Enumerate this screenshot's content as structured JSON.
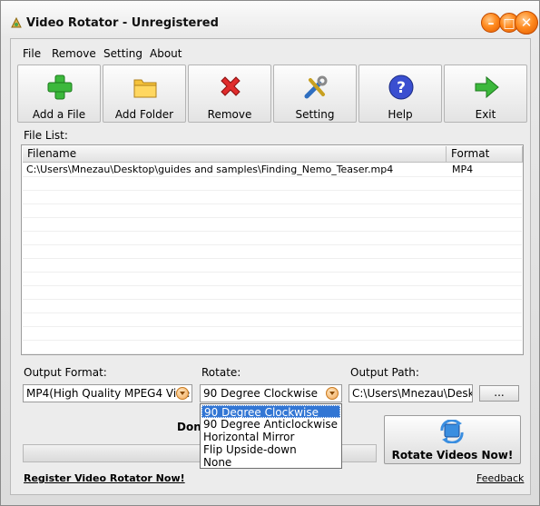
{
  "window": {
    "title": "Video Rotator - Unregistered",
    "buttons": [
      "minimize-button",
      "maximize-button",
      "close-button"
    ]
  },
  "menu": [
    "File",
    "Remove",
    "Setting",
    "About"
  ],
  "toolbar": [
    {
      "label": "Add a File",
      "icon": "green-plus-icon"
    },
    {
      "label": "Add Folder",
      "icon": "folder-icon"
    },
    {
      "label": "Remove",
      "icon": "red-x-icon"
    },
    {
      "label": "Setting",
      "icon": "tools-icon"
    },
    {
      "label": "Help",
      "icon": "help-icon"
    },
    {
      "label": "Exit",
      "icon": "green-arrow-icon"
    }
  ],
  "file_list": {
    "label": "File List:",
    "columns": [
      "Filename",
      "Format"
    ],
    "rows": [
      {
        "filename": "C:\\Users\\Mnezau\\Desktop\\guides and samples\\Finding_Nemo_Teaser.mp4",
        "format": "MP4"
      }
    ]
  },
  "output_format": {
    "label": "Output Format:",
    "value": "MP4(High Quality MPEG4 Vide"
  },
  "rotate": {
    "label": "Rotate:",
    "value": "90 Degree Clockwise",
    "options": [
      "90 Degree Clockwise",
      "90 Degree Anticlockwise",
      "Horizontal Mirror",
      "Flip Upside-down",
      "None"
    ],
    "selected_index": 0
  },
  "output_path": {
    "label": "Output Path:",
    "value": "C:\\Users\\Mnezau\\Desktc",
    "browse_label": "..."
  },
  "status": {
    "text": "Don",
    "progress": 0
  },
  "rotate_button": {
    "label": "Rotate Videos Now!",
    "icon": "rotate-icon"
  },
  "links": {
    "register": "Register Video Rotator Now!",
    "feedback": "Feedback"
  },
  "colors": {
    "accent_orange": "#ff8a1e",
    "selection_blue": "#3276d4"
  }
}
